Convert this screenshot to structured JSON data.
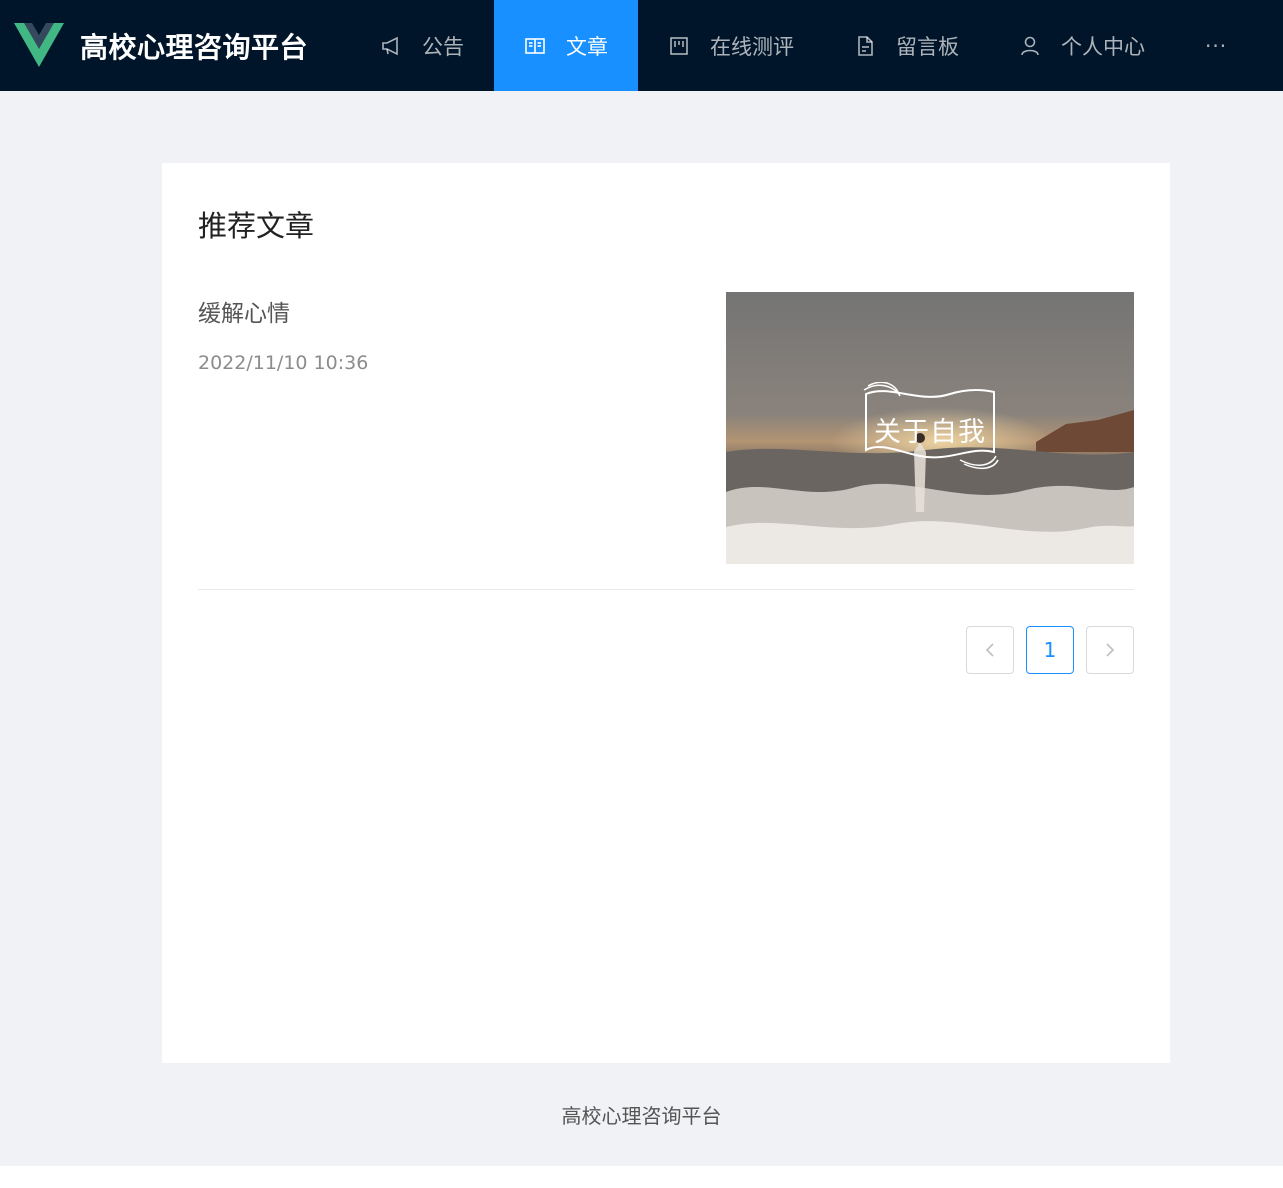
{
  "header": {
    "brand_title": "高校心理咨询平台",
    "nav": [
      {
        "label": "公告",
        "icon": "megaphone-icon",
        "active": false
      },
      {
        "label": "文章",
        "icon": "book-icon",
        "active": true
      },
      {
        "label": "在线测评",
        "icon": "board-icon",
        "active": false
      },
      {
        "label": "留言板",
        "icon": "document-icon",
        "active": false
      },
      {
        "label": "个人中心",
        "icon": "user-icon",
        "active": false
      }
    ],
    "more_label": "···"
  },
  "main": {
    "section_title": "推荐文章",
    "articles": [
      {
        "title": "缓解心情",
        "date": "2022/11/10 10:36",
        "thumb_caption": "关于自我"
      }
    ]
  },
  "pagination": {
    "prev_label": "<",
    "current_page": "1",
    "next_label": ">"
  },
  "footer": {
    "text": "高校心理咨询平台"
  },
  "colors": {
    "header_bg": "#001529",
    "accent": "#1890ff",
    "page_bg": "#f0f2f5"
  }
}
